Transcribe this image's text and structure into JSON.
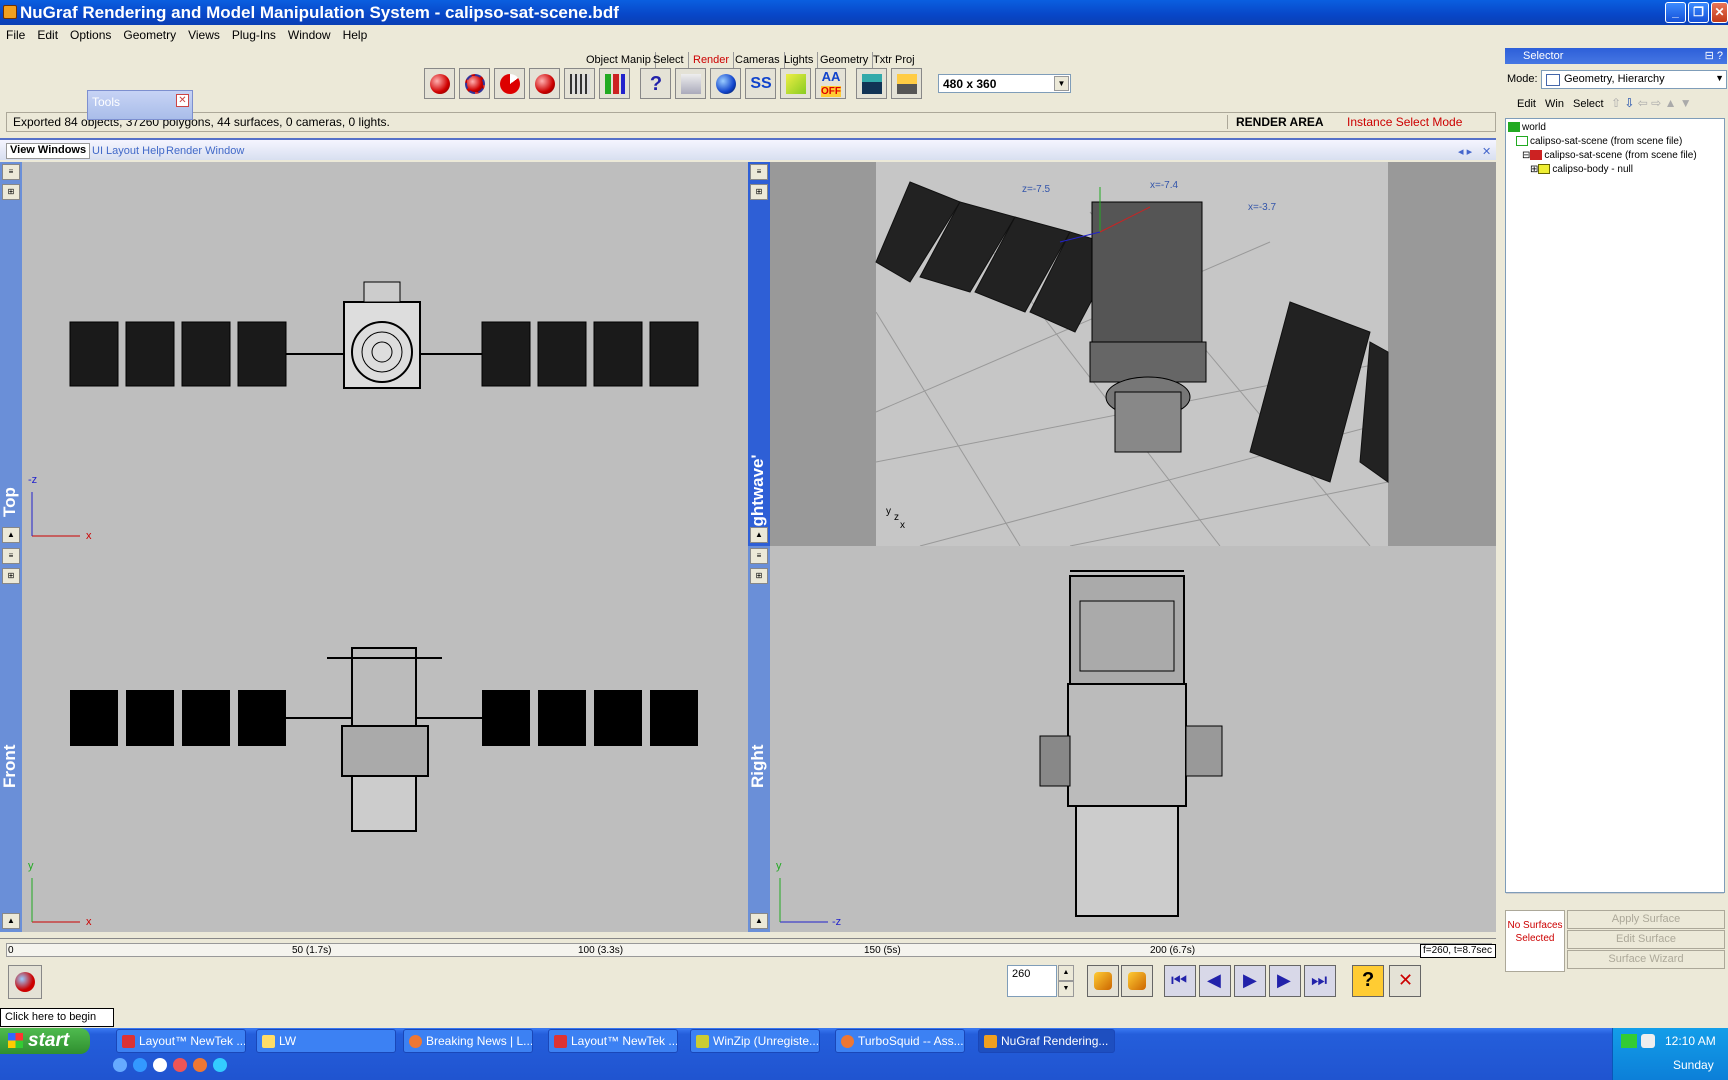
{
  "window": {
    "title": "NuGraf Rendering and Model Manipulation System - calipso-sat-scene.bdf"
  },
  "menu": [
    "File",
    "Edit",
    "Options",
    "Geometry",
    "Views",
    "Plug-Ins",
    "Window",
    "Help"
  ],
  "toolbar_tabs": [
    "Object Manip",
    "Select",
    "Render",
    "Cameras",
    "Lights",
    "Geometry",
    "Txtr Proj"
  ],
  "toolbar_active_tab": "Render",
  "toolbar_icons": [
    "render-sphere-icon",
    "render-region-icon",
    "render-partial-icon",
    "render-save-icon",
    "render-stats-icon",
    "render-chart-icon",
    "render-help-icon",
    "render-options-icon",
    "render-material-icon",
    "supersample-icon",
    "texture-cube-icon",
    "antialias-off-icon",
    "save-image-icon",
    "print-image-icon"
  ],
  "toolbar_text_labels": {
    "ss": "SS",
    "aa": "AA",
    "aa_off": "OFF"
  },
  "resolution": "480 x 360",
  "tools_palette": {
    "title": "Tools"
  },
  "status": {
    "message": "Exported 84 objects, 37260 polygons, 44 surfaces, 0 cameras, 0 lights.",
    "render_area": "RENDER AREA",
    "mode": "Instance Select Mode"
  },
  "view_tabs": [
    "View Windows",
    "UI Layout Help",
    "Render Window"
  ],
  "viewports": {
    "top": {
      "label": "Top",
      "axis1": "-z",
      "axis2": "x"
    },
    "perspective": {
      "label": "'lightwave'",
      "tags": [
        "z=-7.5",
        "x=-7.4",
        "x=-3.7"
      ],
      "axes": [
        "y",
        "z",
        "x"
      ]
    },
    "front": {
      "label": "Front",
      "axis1": "y",
      "axis2": "x"
    },
    "right": {
      "label": "Right",
      "axis1": "y",
      "axis2": "-z"
    }
  },
  "selector": {
    "title": "Selector",
    "mode_label": "Mode:",
    "mode_value": "Geometry, Hierarchy",
    "menu": [
      "Edit",
      "Win",
      "Select"
    ],
    "tree": [
      "world",
      "calipso-sat-scene (from scene file)",
      "calipso-sat-scene (from scene file)",
      "calipso-body - null"
    ],
    "no_surfaces": "No Surfaces Selected",
    "buttons": [
      "Apply Surface",
      "Edit Surface",
      "Surface Wizard"
    ]
  },
  "timeline": {
    "ticks": [
      "0",
      "50 (1.7s)",
      "100 (3.3s)",
      "150 (5s)",
      "200 (6.7s)"
    ],
    "frame_info": "f=260, t=8.7sec",
    "frame": "260"
  },
  "tooltip": "Click here to begin",
  "taskbar": {
    "start": "start",
    "tasks": [
      "Layout™ NewTek ...",
      "LW",
      "Breaking News | L...",
      "Layout™ NewTek ...",
      "WinZip (Unregiste...",
      "TurboSquid -- Ass...",
      "NuGraf Rendering..."
    ],
    "time": "12:10 AM",
    "day": "Sunday"
  },
  "colors": {
    "titlebar": "#0846c7",
    "viewport_bg": "#bebebe",
    "active_tab": "#cc0000",
    "taskbar": "#245edb"
  }
}
